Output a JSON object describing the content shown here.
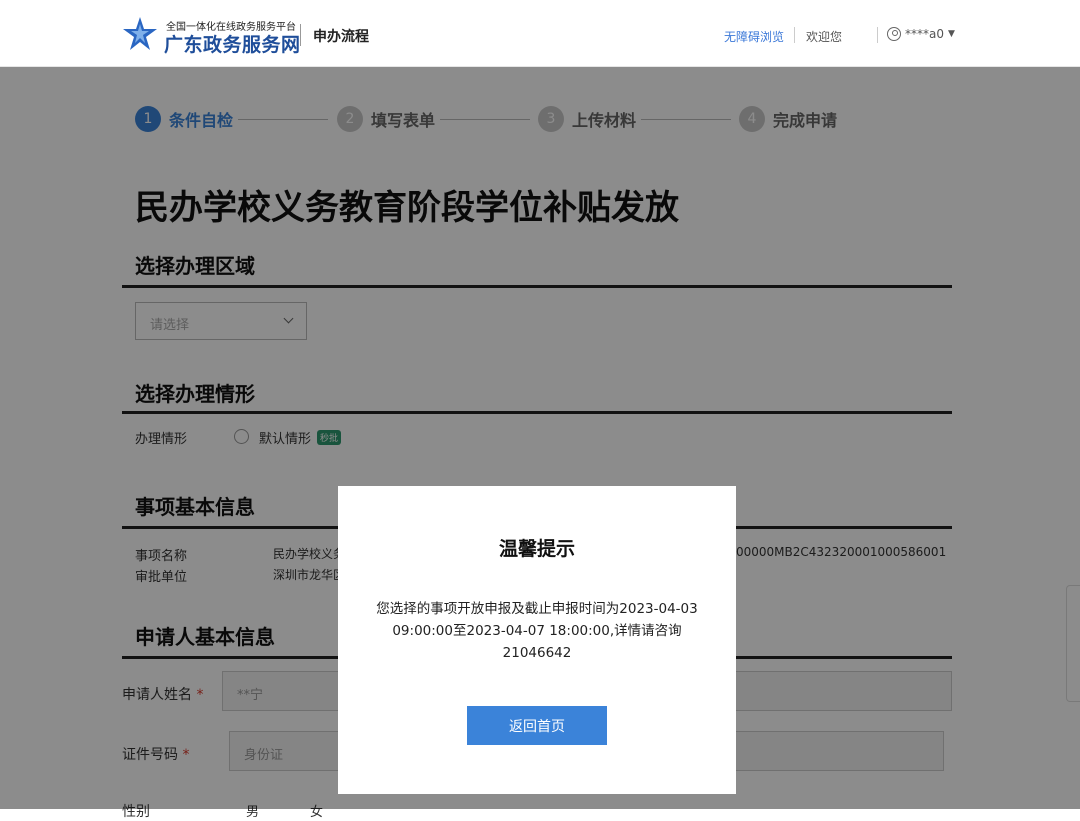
{
  "header": {
    "logo_sub": "全国一体化在线政务服务平台",
    "logo_main": "广东政务服务网",
    "section_title": "申办流程",
    "accessibility_link": "无障碍浏览",
    "welcome": "欢迎您",
    "user": "****a0",
    "brand_color": "#1f4e9a",
    "accent_color": "#3b83d9"
  },
  "steps": [
    {
      "num": "1",
      "label": "条件自检",
      "state": "active"
    },
    {
      "num": "2",
      "label": "填写表单",
      "state": "inactive"
    },
    {
      "num": "3",
      "label": "上传材料",
      "state": "inactive"
    },
    {
      "num": "4",
      "label": "完成申请",
      "state": "inactive"
    }
  ],
  "page_title": "民办学校义务教育阶段学位补贴发放",
  "region": {
    "title": "选择办理区域",
    "placeholder": "请选择"
  },
  "situation": {
    "title": "选择办理情形",
    "label": "办理情形",
    "option": "默认情形",
    "badge": "秒批"
  },
  "basic_info": {
    "title": "事项基本信息",
    "name_label": "事项名称",
    "name_value": "民办学校义务",
    "code_value": "00000MB2C432320001000586001",
    "unit_label": "审批单位",
    "unit_value": "深圳市龙华区"
  },
  "applicant": {
    "title": "申请人基本信息",
    "name_label": "申请人姓名",
    "name_value": "**宁",
    "id_label": "证件号码",
    "id_value": "身份证",
    "required_mark": "*",
    "gender_label": "性别",
    "gender_male": "男",
    "gender_female": "女"
  },
  "modal": {
    "title": "温馨提示",
    "message": "您选择的事项开放申报及截止申报时间为2023-04-03 09:00:00至2023-04-07 18:00:00,详情请咨询21046642",
    "button": "返回首页"
  }
}
